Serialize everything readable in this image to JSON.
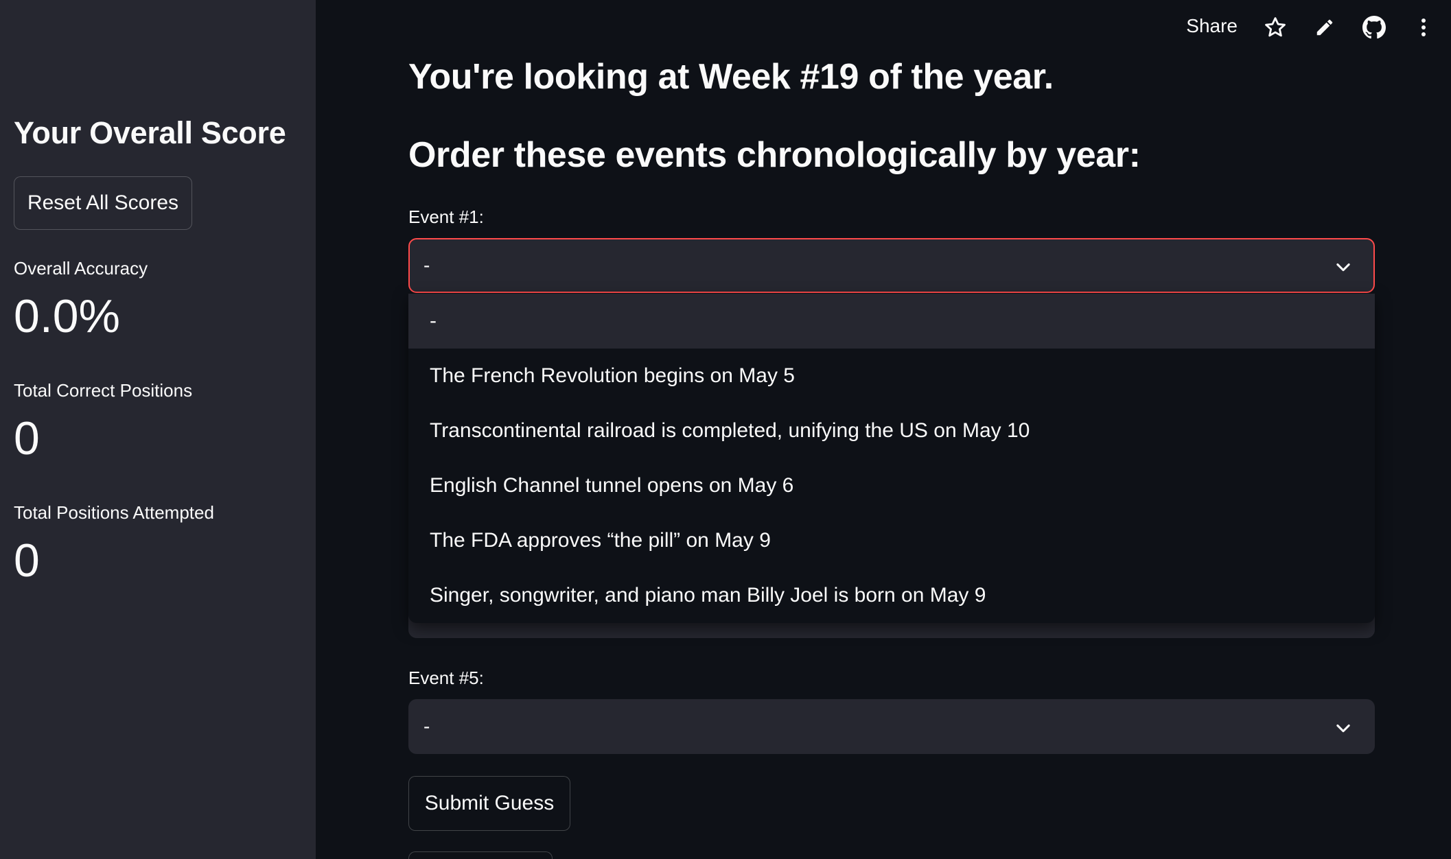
{
  "sidebar": {
    "title": "Your Overall Score",
    "reset_button": "Reset All Scores",
    "metrics": [
      {
        "label": "Overall Accuracy",
        "value": "0.0%"
      },
      {
        "label": "Total Correct Positions",
        "value": "0"
      },
      {
        "label": "Total Positions Attempted",
        "value": "0"
      }
    ]
  },
  "toolbar": {
    "share_label": "Share",
    "icons": [
      "star-icon",
      "pencil-icon",
      "github-icon",
      "more-vertical-icon"
    ]
  },
  "main": {
    "heading_week": "You're looking at Week #19 of the year.",
    "heading_instruction": "Order these events chronologically by year:",
    "event1": {
      "label": "Event #1:",
      "value": "-"
    },
    "event5": {
      "label": "Event #5:",
      "value": "-"
    },
    "dropdown_options": [
      "-",
      "The French Revolution begins on May 5",
      "Transcontinental railroad is completed, unifying the US on May 10",
      "English Channel tunnel opens on May 6",
      "The FDA approves “the pill” on May 9",
      "Singer, songwriter, and piano man Billy Joel is born on May 9"
    ],
    "selected_option_index": 0,
    "submit_button": "Submit Guess"
  },
  "colors": {
    "background": "#0e1117",
    "sidebar": "#262730",
    "accent": "#ff4b4b",
    "text": "#fafafa"
  }
}
